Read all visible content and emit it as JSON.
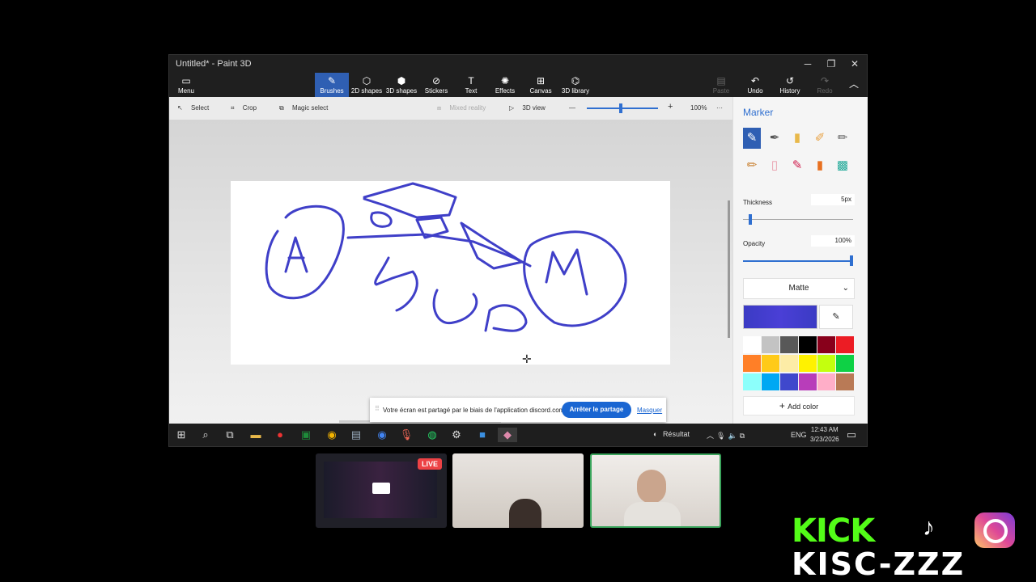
{
  "window": {
    "title": "Untitled* - Paint 3D",
    "controls": {
      "minimize": "─",
      "maximize": "❐",
      "close": "✕"
    }
  },
  "ribbon": {
    "menu": "Menu",
    "tabs": [
      "Brushes",
      "2D shapes",
      "3D shapes",
      "Stickers",
      "Text",
      "Effects",
      "Canvas",
      "3D library"
    ],
    "right": {
      "paste": "Paste",
      "undo": "Undo",
      "history": "History",
      "redo": "Redo"
    }
  },
  "toolbar": {
    "select": "Select",
    "crop": "Crop",
    "magic_select": "Magic select",
    "mixed_reality": "Mixed reality",
    "view3d": "3D view",
    "zoom_minus": "—",
    "zoom_plus": "+",
    "zoom": "100%",
    "more": "···"
  },
  "panel": {
    "title": "Marker",
    "thickness_label": "Thickness",
    "thickness_value": "5px",
    "thickness_level": 0.05,
    "opacity_label": "Opacity",
    "opacity_value": "100%",
    "opacity_level": 1.0,
    "finish": "Matte",
    "current_color": "#3b3bc4",
    "add_color": "Add color",
    "palette": [
      "#ffffff",
      "#c3c3c3",
      "#585858",
      "#000000",
      "#88001b",
      "#ec1c24",
      "#ff7f27",
      "#ffca18",
      "#fdeca6",
      "#fff200",
      "#c4ff0e",
      "#0ed145",
      "#8cfffb",
      "#00a8f3",
      "#3f48cc",
      "#b83dba",
      "#ffaec8",
      "#b97a56"
    ],
    "brushes": [
      "marker",
      "calligraphy-pen",
      "oil-brush",
      "watercolor",
      "pixel-pen",
      "pencil",
      "eraser",
      "crayon",
      "spray-can",
      "fill"
    ]
  },
  "notification": {
    "text": "Votre écran est partagé par le biais de l'application discord.com.",
    "stop_button": "Arrêter le partage",
    "hide_link": "Masquer"
  },
  "taskbar": {
    "weather": "Résultat",
    "lang": "ENG",
    "time": "12:43 AM",
    "date": "3/23/2026"
  },
  "overlay": {
    "live_badge": "LIVE",
    "brand": "KISC-ZZZ",
    "kick": "KICK"
  },
  "drawing": {
    "letters": [
      "A",
      "M"
    ],
    "stroke_color": "#3f3fc8"
  }
}
